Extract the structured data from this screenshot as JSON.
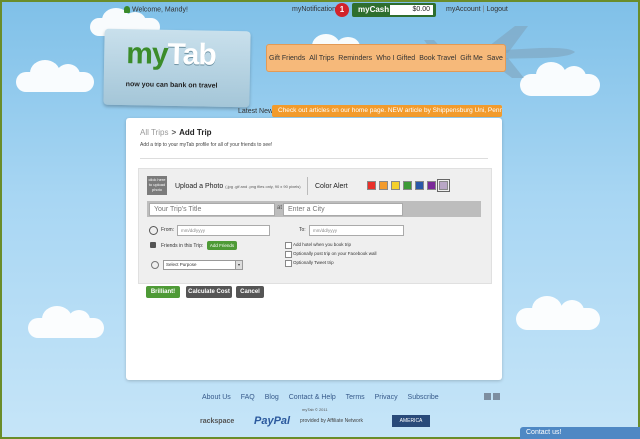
{
  "topbar": {
    "welcome": "Welcome, Mandy!",
    "notifications_label": "myNotifications",
    "notifications_count": "1",
    "mycash_label": "myCash",
    "mycash_amount": "$0.00",
    "my_account": "myAccount",
    "separator": "|",
    "logout": "Logout"
  },
  "brand": {
    "logo_my": "my",
    "logo_tab": "Tab",
    "tagline": "now you can bank on travel"
  },
  "nav": {
    "items": [
      "Gift Friends",
      "All Trips",
      "Reminders",
      "Who I Gifted",
      "Book Travel",
      "Gift Me",
      "Save"
    ]
  },
  "news": {
    "label": "Latest News:",
    "text": "Check out articles on our home page.  NEW article by Shippensburg Uni, Penn State!"
  },
  "page": {
    "breadcrumb_parent": "All Trips",
    "breadcrumb_arrow": ">",
    "breadcrumb_current": "Add Trip",
    "subtitle": "Add a trip to your myTab profile for all of your friends to see!"
  },
  "form": {
    "photo_box": "click here to upload photo",
    "upload_title": "Upload a Photo",
    "upload_hint": "(.jpg .gif and .png files only, 90 x 90 pixels)",
    "color_alert": "Color Alert",
    "swatches": [
      "#e8302a",
      "#f29b2c",
      "#f5d02a",
      "#3d9a36",
      "#2a58a8",
      "#7a2a98",
      "#b9a7c6"
    ],
    "trip_title_placeholder": "Your Trip's Title",
    "at_label": "at",
    "city_placeholder": "Enter a City",
    "from_label": "From:",
    "from_placeholder": "mm/dd/yyyy",
    "to_label": "To:",
    "to_placeholder": "mm/dd/yyyy",
    "friends_label": "Friends in this Trip:",
    "add_friends": "Add Friends",
    "purpose_value": "Select Purpose",
    "dropdown_arrow": "▾",
    "checkboxes": [
      "Add hotel when you book trip",
      "Optionally post trip on your Facebook wall",
      "Optionally Tweet trip"
    ]
  },
  "buttons": {
    "brilliant": "Brilliant!",
    "calculate": "Calculate Cost",
    "cancel": "Cancel"
  },
  "footer": {
    "links": [
      "About Us",
      "FAQ",
      "Blog",
      "Contact & Help",
      "Terms",
      "Privacy",
      "Subscribe"
    ],
    "copyright": "myTab © 2011",
    "partners": {
      "rackspace": "rackspace",
      "paypal": "PayPal",
      "affiliate": "provided by Affiliate Network",
      "america": "AMERICA"
    }
  },
  "contact": "Contact us!"
}
